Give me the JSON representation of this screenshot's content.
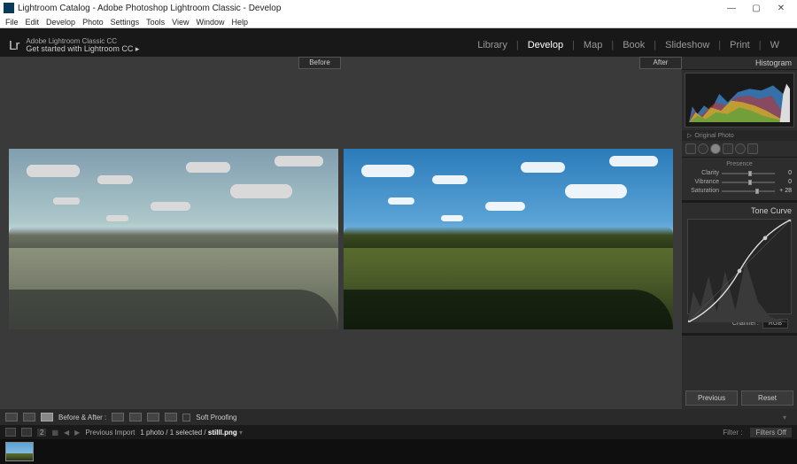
{
  "window": {
    "title": "Lightroom Catalog - Adobe Photoshop Lightroom Classic - Develop"
  },
  "menu": [
    "File",
    "Edit",
    "Develop",
    "Photo",
    "Settings",
    "Tools",
    "View",
    "Window",
    "Help"
  ],
  "header": {
    "logo": "Lr",
    "title_small": "Adobe Lightroom Classic CC",
    "subtitle": "Get started with Lightroom CC  ▸"
  },
  "modules": {
    "items": [
      "Library",
      "Develop",
      "Map",
      "Book",
      "Slideshow",
      "Print",
      "W"
    ],
    "active": "Develop"
  },
  "viewer": {
    "before_label": "Before",
    "after_label": "After"
  },
  "right": {
    "histogram_label": "Histogram",
    "original_photo": "Original Photo",
    "presence_label": "Presence",
    "sliders": [
      {
        "label": "Clarity",
        "value": "0",
        "pos": 50
      },
      {
        "label": "Vibrance",
        "value": "0",
        "pos": 50
      },
      {
        "label": "Saturation",
        "value": "+ 28",
        "pos": 64
      }
    ],
    "tone_curve_label": "Tone Curve",
    "channel_label": "Channel :",
    "channel_value": "RGB",
    "prev_btn": "Previous",
    "reset_btn": "Reset"
  },
  "toolbar": {
    "ba_label": "Before & After :",
    "soft_proof": "Soft Proofing"
  },
  "filmstrip": {
    "count_badge": "2",
    "collection": "Previous Import",
    "status": "1 photo / 1 selected /",
    "filename": "stilll.png",
    "filter_label": "Filter :",
    "filter_value": "Filters Off"
  }
}
